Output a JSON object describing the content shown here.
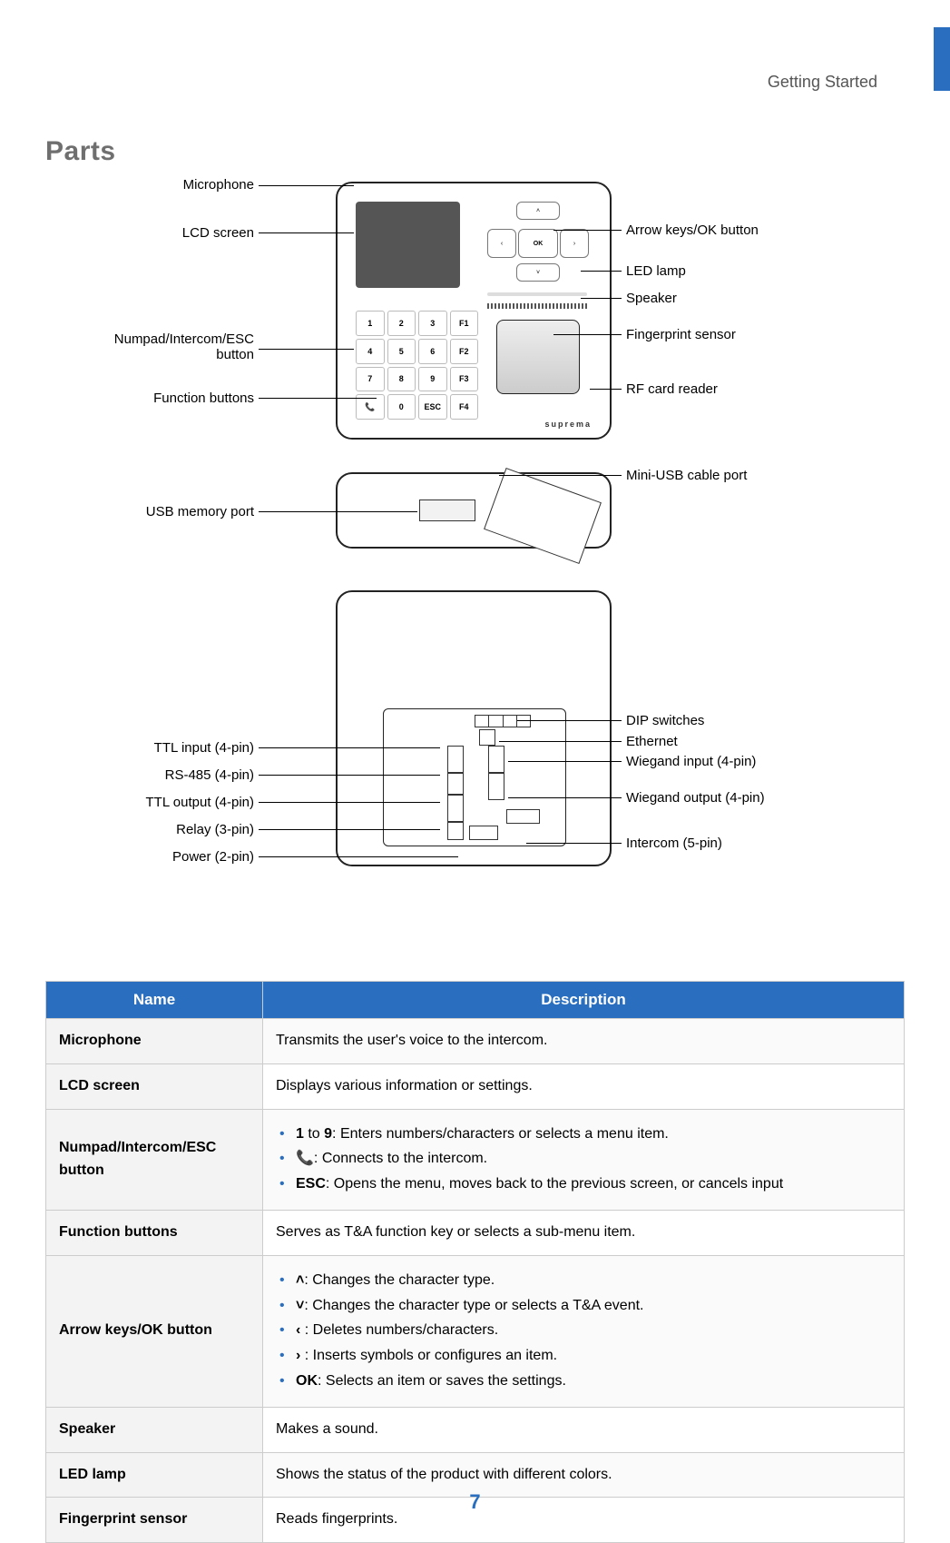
{
  "header": {
    "breadcrumb": "Getting Started"
  },
  "section": {
    "title": "Parts"
  },
  "page_number": "7",
  "diagram": {
    "front": {
      "left_labels": {
        "microphone": "Microphone",
        "lcd": "LCD screen",
        "numpad_esc": "Numpad/Intercom/ESC\nbutton",
        "function_buttons": "Function buttons"
      },
      "right_labels": {
        "arrow_ok": "Arrow keys/OK button",
        "led_lamp": "LED lamp",
        "speaker": "Speaker",
        "fingerprint": "Fingerprint sensor",
        "rf_reader": "RF card reader"
      },
      "keypad_keys": [
        "1",
        "2",
        "3",
        "F1",
        "4",
        "5",
        "6",
        "F2",
        "7",
        "8",
        "9",
        "F3",
        "📞",
        "0",
        "ESC",
        "F4"
      ],
      "arrowpad": {
        "up": "˄",
        "down": "˅",
        "left": "‹",
        "right": "›",
        "ok": "OK"
      },
      "brand": "suprema"
    },
    "bottom": {
      "left_labels": {
        "usb_memory": "USB memory port"
      },
      "right_labels": {
        "mini_usb": "Mini-USB cable port"
      }
    },
    "back": {
      "left_labels": {
        "ttl_input": "TTL input (4-pin)",
        "rs485": "RS-485 (4-pin)",
        "ttl_output": "TTL output (4-pin)",
        "relay": "Relay (3-pin)",
        "power": "Power (2-pin)"
      },
      "right_labels": {
        "dip": "DIP switches",
        "ethernet": "Ethernet",
        "wieg_in": "Wiegand input (4-pin)",
        "wieg_out": "Wiegand output (4-pin)",
        "intercom": "Intercom (5-pin)"
      }
    }
  },
  "table": {
    "headers": {
      "name": "Name",
      "description": "Description"
    },
    "rows": [
      {
        "name": "Microphone",
        "desc_type": "text",
        "desc": "Transmits the user's voice to the intercom."
      },
      {
        "name": "LCD screen",
        "desc_type": "text",
        "desc": "Displays various information or settings."
      },
      {
        "name": "Numpad/Intercom/ESC button",
        "desc_type": "numpad_list",
        "items": {
          "line1_prefix": "1",
          "line1_mid": " to ",
          "line1_em": "9",
          "line1_rest": ": Enters numbers/characters or selects a menu item.",
          "line2_icon": "📞",
          "line2_rest": ": Connects to the intercom.",
          "line3_em": "ESC",
          "line3_rest": ": Opens the menu, moves back to the previous screen, or cancels input"
        }
      },
      {
        "name": "Function buttons",
        "desc_type": "text",
        "desc": "Serves as T&A function key or selects a sub-menu item."
      },
      {
        "name": "Arrow keys/OK button",
        "desc_type": "arrow_list",
        "items": {
          "up_sym": "˄",
          "up_rest": ": Changes the character type.",
          "down_sym": "˅",
          "down_rest": ": Changes the character type or selects a T&A event.",
          "left_sym": "‹",
          "left_rest": " : Deletes numbers/characters.",
          "right_sym": "›",
          "right_rest": " : Inserts symbols or configures an item.",
          "ok_em": "OK",
          "ok_rest": ": Selects an item or saves the settings."
        }
      },
      {
        "name": "Speaker",
        "desc_type": "text",
        "desc": "Makes a sound."
      },
      {
        "name": "LED lamp",
        "desc_type": "text",
        "desc": "Shows the status of the product with different colors."
      },
      {
        "name": "Fingerprint sensor",
        "desc_type": "text",
        "desc": "Reads fingerprints."
      }
    ]
  }
}
